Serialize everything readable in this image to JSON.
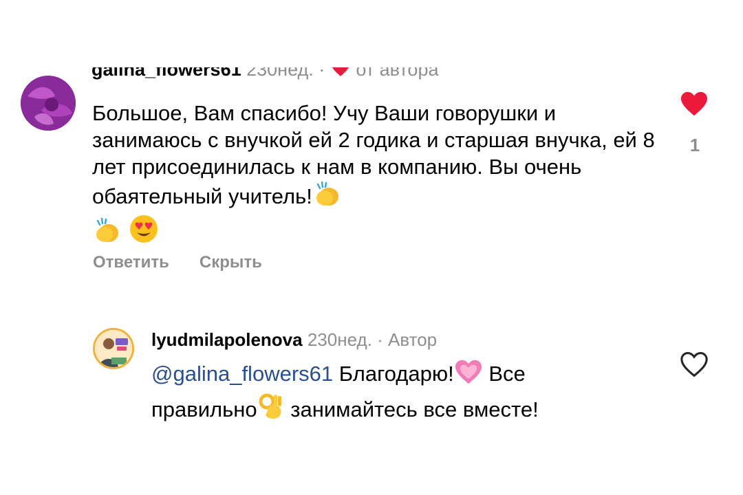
{
  "comment": {
    "username": "galina_flowers61",
    "time": "230нед.",
    "separator": "·",
    "by_author": "от автора",
    "text_main": "Большое, Вам спасибо!  Учу Ваши говорушки и занимаюсь с внучкой ей 2 годика и старшая внучка, ей 8 лет присоединилась к нам в компанию. Вы очень обаятельный учитель!",
    "emojis_inline": "clapping-hands",
    "emojis_next": [
      "clapping-hands",
      "heart-eyes"
    ],
    "reply_label": "Ответить",
    "hide_label": "Скрыть",
    "like_count": "1",
    "like_color": "#ED1A3B"
  },
  "reply": {
    "username": "lyudmilapolenova",
    "time": "230нед.",
    "separator": "·",
    "role": "Автор",
    "mention": "@galina_flowers61",
    "text_part1": "Благодарю!",
    "heart_emoji": "sparkling-heart",
    "text_part2": "Все",
    "text_part3": "правильно",
    "ok_emoji": "ok-hand",
    "text_part4": "занимайтесь все вместе!"
  },
  "colors": {
    "meta": "#8E8E8E",
    "mention": "#2A4F8B",
    "like": "#ED1A3B"
  }
}
